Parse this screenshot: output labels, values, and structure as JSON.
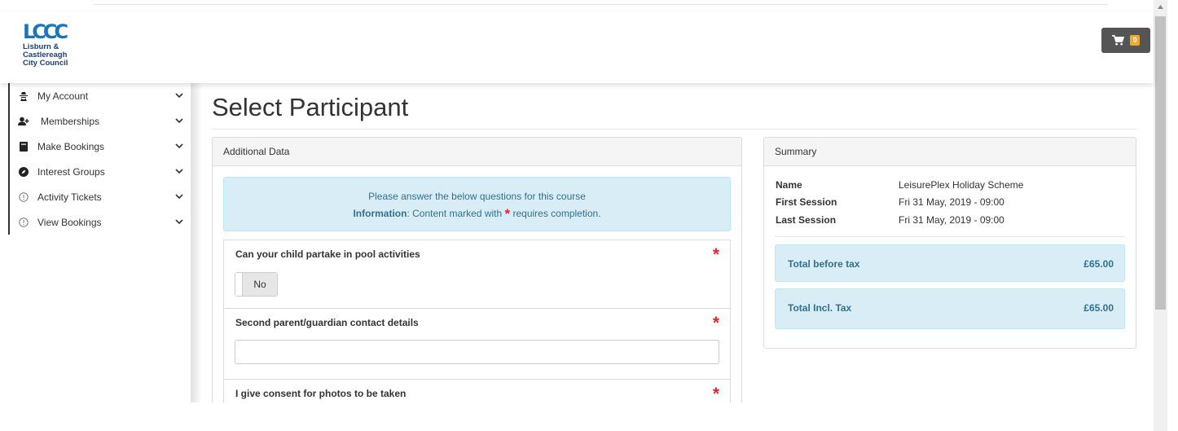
{
  "header": {
    "logo_mark": "LCCC",
    "logo_lines": [
      "Lisburn &",
      "Castlereagh",
      "City Council"
    ],
    "cart_count": "0",
    "cart_icon": "shopping-cart-icon"
  },
  "sidebar": {
    "items": [
      {
        "label": "My Account",
        "icon": "user-secret-icon"
      },
      {
        "label": "Memberships",
        "icon": "user-plus-icon"
      },
      {
        "label": "Make Bookings",
        "icon": "book-icon"
      },
      {
        "label": "Interest Groups",
        "icon": "compass-icon"
      },
      {
        "label": "Activity Tickets",
        "icon": "info-circle-icon"
      },
      {
        "label": "View Bookings",
        "icon": "info-circle-icon"
      }
    ]
  },
  "main": {
    "title": "Select Participant",
    "additional": {
      "heading": "Additional Data",
      "info_line1": "Please answer the below questions for this course",
      "info_bold": "Information",
      "info_text": ": Content marked with ",
      "info_text2": " requires completion.",
      "star": "*",
      "questions": [
        {
          "label": "Can your child partake in pool activities",
          "type": "toggle",
          "value": "No"
        },
        {
          "label": "Second parent/guardian contact details",
          "type": "text",
          "value": ""
        },
        {
          "label": "I give consent for photos to be taken",
          "type": "toggle",
          "value": ""
        }
      ]
    },
    "summary": {
      "heading": "Summary",
      "rows": [
        {
          "key": "Name",
          "value": "LeisurePlex Holiday Scheme"
        },
        {
          "key": "First Session",
          "value": "Fri 31 May, 2019 - 09:00"
        },
        {
          "key": "Last Session",
          "value": "Fri 31 May, 2019 - 09:00"
        }
      ],
      "totals": [
        {
          "key": "Total before tax",
          "value": "£65.00"
        },
        {
          "key": "Total Incl. Tax",
          "value": "£65.00"
        }
      ]
    }
  },
  "colors": {
    "brand_blue": "#1b73b8",
    "info_bg": "#d9edf7",
    "info_text": "#31708f",
    "required_red": "#e8262f",
    "cart_bg": "#555555",
    "badge": "#f0a830"
  }
}
